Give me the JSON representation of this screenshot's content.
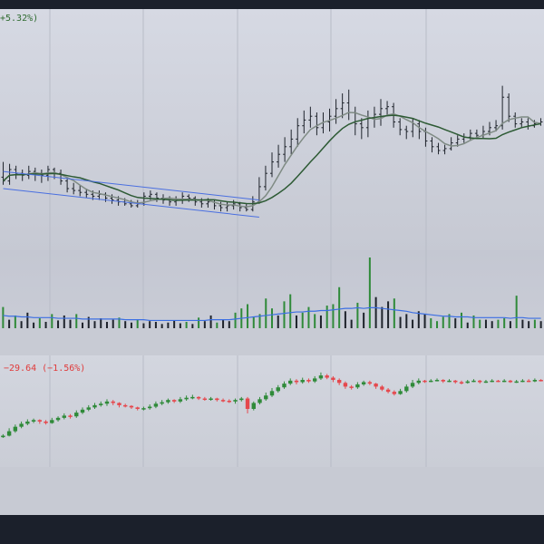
{
  "colors": {
    "up": "#2f8a39",
    "down": "#e5484d",
    "bar_dark": "#1e232b",
    "sma_fast": "#7f8b84",
    "sma_slow": "#2d5a34",
    "channel": "#4a6fe0",
    "volume_ma": "#3c6fe3",
    "grid": "#b8bcc7"
  },
  "legend": {
    "price_change": "+5.32%)",
    "compare_change": "−29.64 (−1.56%)"
  },
  "chart_data": [
    {
      "type": "ohlc",
      "pane": "price",
      "indicators": [
        "fast moving average",
        "slow moving average",
        "descending channel"
      ],
      "ylim": [
        0,
        100
      ],
      "bars": [
        [
          26,
          24,
          34,
          22
        ],
        [
          24,
          30,
          33,
          22
        ],
        [
          30,
          28,
          32,
          25
        ],
        [
          28,
          27,
          30,
          24
        ],
        [
          27,
          29,
          32,
          25
        ],
        [
          29,
          28,
          31,
          24
        ],
        [
          28,
          27,
          30,
          23
        ],
        [
          27,
          30,
          32,
          24
        ],
        [
          30,
          28,
          31,
          25
        ],
        [
          28,
          24,
          30,
          22
        ],
        [
          24,
          20,
          26,
          18
        ],
        [
          20,
          19,
          23,
          17
        ],
        [
          19,
          18,
          22,
          16
        ],
        [
          18,
          17,
          20,
          15
        ],
        [
          17,
          16,
          19,
          14
        ],
        [
          16,
          17,
          19,
          14
        ],
        [
          17,
          15,
          18,
          13
        ],
        [
          15,
          14,
          17,
          12
        ],
        [
          14,
          13,
          16,
          11
        ],
        [
          13,
          12,
          15,
          11
        ],
        [
          12,
          11,
          14,
          10
        ],
        [
          11,
          12,
          14,
          10
        ],
        [
          12,
          16,
          18,
          11
        ],
        [
          16,
          17,
          19,
          14
        ],
        [
          17,
          15,
          18,
          13
        ],
        [
          15,
          14,
          17,
          12
        ],
        [
          14,
          13,
          16,
          11
        ],
        [
          13,
          14,
          16,
          11
        ],
        [
          14,
          16,
          18,
          12
        ],
        [
          16,
          15,
          17,
          13
        ],
        [
          15,
          13,
          16,
          11
        ],
        [
          13,
          12,
          15,
          10
        ],
        [
          12,
          13,
          15,
          10
        ],
        [
          13,
          11,
          14,
          9
        ],
        [
          11,
          10,
          13,
          8
        ],
        [
          10,
          11,
          13,
          8
        ],
        [
          11,
          12,
          14,
          9
        ],
        [
          12,
          10,
          13,
          8
        ],
        [
          10,
          9,
          12,
          8
        ],
        [
          9,
          13,
          16,
          8
        ],
        [
          13,
          21,
          26,
          12
        ],
        [
          21,
          28,
          32,
          19
        ],
        [
          28,
          34,
          39,
          26
        ],
        [
          34,
          38,
          43,
          31
        ],
        [
          38,
          42,
          47,
          34
        ],
        [
          42,
          46,
          51,
          38
        ],
        [
          46,
          53,
          57,
          42
        ],
        [
          53,
          56,
          61,
          49
        ],
        [
          56,
          58,
          63,
          52
        ],
        [
          58,
          52,
          60,
          48
        ],
        [
          52,
          55,
          60,
          49
        ],
        [
          55,
          58,
          62,
          50
        ],
        [
          58,
          62,
          67,
          54
        ],
        [
          62,
          65,
          70,
          57
        ],
        [
          65,
          60,
          72,
          56
        ],
        [
          60,
          54,
          63,
          48
        ],
        [
          54,
          52,
          57,
          46
        ],
        [
          52,
          57,
          61,
          47
        ],
        [
          57,
          59,
          63,
          52
        ],
        [
          59,
          62,
          67,
          53
        ],
        [
          62,
          63,
          66,
          58
        ],
        [
          63,
          55,
          65,
          52
        ],
        [
          55,
          51,
          57,
          48
        ],
        [
          51,
          50,
          53,
          46
        ],
        [
          50,
          54,
          57,
          47
        ],
        [
          54,
          50,
          56,
          46
        ],
        [
          50,
          45,
          52,
          42
        ],
        [
          45,
          42,
          47,
          39
        ],
        [
          42,
          40,
          44,
          38
        ],
        [
          40,
          41,
          43,
          38
        ],
        [
          41,
          44,
          47,
          40
        ],
        [
          44,
          46,
          48,
          42
        ],
        [
          46,
          47,
          49,
          44
        ],
        [
          47,
          49,
          51,
          45
        ],
        [
          49,
          48,
          51,
          46
        ],
        [
          48,
          50,
          53,
          46
        ],
        [
          50,
          52,
          55,
          48
        ],
        [
          52,
          53,
          56,
          50
        ],
        [
          53,
          68,
          74,
          51
        ],
        [
          68,
          58,
          70,
          55
        ],
        [
          58,
          54,
          60,
          52
        ],
        [
          54,
          55,
          57,
          52
        ],
        [
          55,
          53,
          57,
          51
        ],
        [
          53,
          54,
          56,
          52
        ],
        [
          54,
          55,
          57,
          53
        ]
      ]
    },
    {
      "type": "bar",
      "pane": "volume",
      "indicators": [
        "volume moving average"
      ],
      "ylim": [
        0,
        100
      ],
      "values": [
        30,
        12,
        18,
        10,
        22,
        8,
        14,
        9,
        20,
        11,
        18,
        12,
        20,
        8,
        16,
        10,
        14,
        9,
        12,
        15,
        10,
        8,
        12,
        7,
        10,
        9,
        6,
        8,
        11,
        7,
        9,
        6,
        15,
        10,
        18,
        8,
        12,
        10,
        22,
        28,
        34,
        16,
        20,
        42,
        28,
        18,
        38,
        48,
        18,
        22,
        30,
        20,
        18,
        32,
        34,
        58,
        24,
        12,
        36,
        22,
        100,
        44,
        30,
        38,
        42,
        16,
        20,
        12,
        24,
        20,
        14,
        10,
        16,
        20,
        14,
        22,
        8,
        18,
        12,
        12,
        10,
        12,
        14,
        10,
        46,
        12,
        10,
        12,
        10
      ],
      "direction": [
        "u",
        "d",
        "u",
        "d",
        "d",
        "d",
        "u",
        "d",
        "u",
        "d",
        "d",
        "d",
        "u",
        "d",
        "d",
        "d",
        "d",
        "d",
        "d",
        "u",
        "d",
        "d",
        "u",
        "d",
        "d",
        "d",
        "d",
        "d",
        "d",
        "d",
        "u",
        "d",
        "u",
        "d",
        "d",
        "u",
        "d",
        "d",
        "u",
        "u",
        "u",
        "u",
        "u",
        "u",
        "u",
        "d",
        "u",
        "u",
        "d",
        "u",
        "u",
        "u",
        "d",
        "u",
        "u",
        "u",
        "d",
        "d",
        "u",
        "d",
        "u",
        "d",
        "d",
        "d",
        "u",
        "d",
        "d",
        "d",
        "d",
        "d",
        "u",
        "u",
        "u",
        "u",
        "d",
        "u",
        "d",
        "u",
        "u",
        "d",
        "d",
        "u",
        "u",
        "d",
        "u",
        "d",
        "d",
        "u",
        "d"
      ],
      "ma": [
        18,
        17,
        17,
        16,
        16,
        15,
        15,
        15,
        15,
        14,
        14,
        14,
        14,
        13,
        13,
        13,
        13,
        13,
        13,
        13,
        12,
        12,
        12,
        12,
        11,
        11,
        11,
        11,
        11,
        11,
        11,
        11,
        11,
        11,
        12,
        12,
        12,
        12,
        13,
        14,
        15,
        16,
        17,
        18,
        19,
        20,
        21,
        22,
        23,
        23,
        24,
        24,
        25,
        25,
        26,
        27,
        28,
        28,
        29,
        28,
        29,
        29,
        28,
        27,
        26,
        25,
        24,
        22,
        21,
        20,
        19,
        18,
        17,
        17,
        16,
        16,
        16,
        15,
        15,
        15,
        15,
        15,
        15,
        14,
        15,
        15,
        14,
        14,
        14
      ]
    },
    {
      "type": "candlestick",
      "pane": "compare",
      "ylim": [
        0,
        100
      ],
      "bars": [
        [
          12,
          14,
          16,
          11
        ],
        [
          14,
          20,
          24,
          13
        ],
        [
          20,
          26,
          29,
          18
        ],
        [
          26,
          30,
          33,
          24
        ],
        [
          30,
          33,
          36,
          28
        ],
        [
          33,
          35,
          37,
          31
        ],
        [
          35,
          33,
          36,
          30
        ],
        [
          33,
          31,
          35,
          29
        ],
        [
          31,
          35,
          38,
          30
        ],
        [
          35,
          38,
          40,
          33
        ],
        [
          38,
          41,
          44,
          36
        ],
        [
          41,
          40,
          43,
          37
        ],
        [
          40,
          45,
          48,
          38
        ],
        [
          45,
          49,
          52,
          43
        ],
        [
          49,
          52,
          55,
          47
        ],
        [
          52,
          55,
          58,
          50
        ],
        [
          55,
          57,
          60,
          53
        ],
        [
          57,
          60,
          63,
          54
        ],
        [
          60,
          58,
          62,
          55
        ],
        [
          58,
          55,
          59,
          52
        ],
        [
          55,
          54,
          57,
          52
        ],
        [
          54,
          52,
          55,
          50
        ],
        [
          52,
          50,
          53,
          48
        ],
        [
          50,
          51,
          53,
          48
        ],
        [
          51,
          53,
          56,
          49
        ],
        [
          53,
          57,
          60,
          51
        ],
        [
          57,
          59,
          62,
          55
        ],
        [
          59,
          62,
          64,
          57
        ],
        [
          62,
          60,
          63,
          58
        ],
        [
          60,
          63,
          66,
          58
        ],
        [
          63,
          65,
          68,
          61
        ],
        [
          65,
          66,
          69,
          63
        ],
        [
          66,
          64,
          67,
          62
        ],
        [
          64,
          63,
          66,
          61
        ],
        [
          63,
          64,
          66,
          61
        ],
        [
          64,
          62,
          65,
          60
        ],
        [
          62,
          61,
          64,
          59
        ],
        [
          61,
          60,
          63,
          58
        ],
        [
          60,
          62,
          64,
          57
        ],
        [
          62,
          64,
          66,
          60
        ],
        [
          64,
          50,
          66,
          44
        ],
        [
          50,
          58,
          60,
          48
        ],
        [
          58,
          63,
          66,
          56
        ],
        [
          63,
          68,
          72,
          61
        ],
        [
          68,
          74,
          78,
          66
        ],
        [
          74,
          79,
          82,
          72
        ],
        [
          79,
          84,
          87,
          77
        ],
        [
          84,
          88,
          91,
          82
        ],
        [
          88,
          86,
          90,
          83
        ],
        [
          86,
          89,
          92,
          84
        ],
        [
          89,
          87,
          91,
          85
        ],
        [
          87,
          91,
          94,
          85
        ],
        [
          91,
          95,
          99,
          89
        ],
        [
          95,
          92,
          97,
          90
        ],
        [
          92,
          89,
          94,
          86
        ],
        [
          89,
          85,
          91,
          82
        ],
        [
          85,
          80,
          87,
          77
        ],
        [
          80,
          79,
          82,
          76
        ],
        [
          79,
          83,
          86,
          77
        ],
        [
          83,
          86,
          88,
          81
        ],
        [
          86,
          84,
          88,
          82
        ],
        [
          84,
          80,
          85,
          77
        ],
        [
          80,
          76,
          82,
          74
        ],
        [
          76,
          73,
          78,
          71
        ],
        [
          73,
          70,
          75,
          68
        ],
        [
          70,
          74,
          77,
          69
        ],
        [
          74,
          80,
          83,
          72
        ],
        [
          80,
          85,
          89,
          78
        ],
        [
          85,
          88,
          91,
          83
        ],
        [
          88,
          87,
          89,
          85
        ],
        [
          87,
          88,
          90,
          86
        ],
        [
          88,
          89,
          91,
          87
        ],
        [
          89,
          87,
          90,
          85
        ],
        [
          87,
          88,
          90,
          86
        ],
        [
          88,
          86,
          89,
          84
        ],
        [
          86,
          85,
          88,
          83
        ],
        [
          85,
          87,
          89,
          84
        ],
        [
          87,
          88,
          90,
          86
        ],
        [
          88,
          86,
          89,
          84
        ],
        [
          86,
          87,
          89,
          85
        ],
        [
          87,
          88,
          90,
          86
        ],
        [
          88,
          87,
          89,
          86
        ],
        [
          87,
          88,
          90,
          86
        ],
        [
          88,
          86,
          89,
          85
        ],
        [
          86,
          87,
          89,
          85
        ],
        [
          87,
          88,
          90,
          86
        ],
        [
          88,
          87,
          90,
          86
        ],
        [
          87,
          89,
          91,
          86
        ],
        [
          89,
          88,
          90,
          87
        ]
      ]
    }
  ]
}
